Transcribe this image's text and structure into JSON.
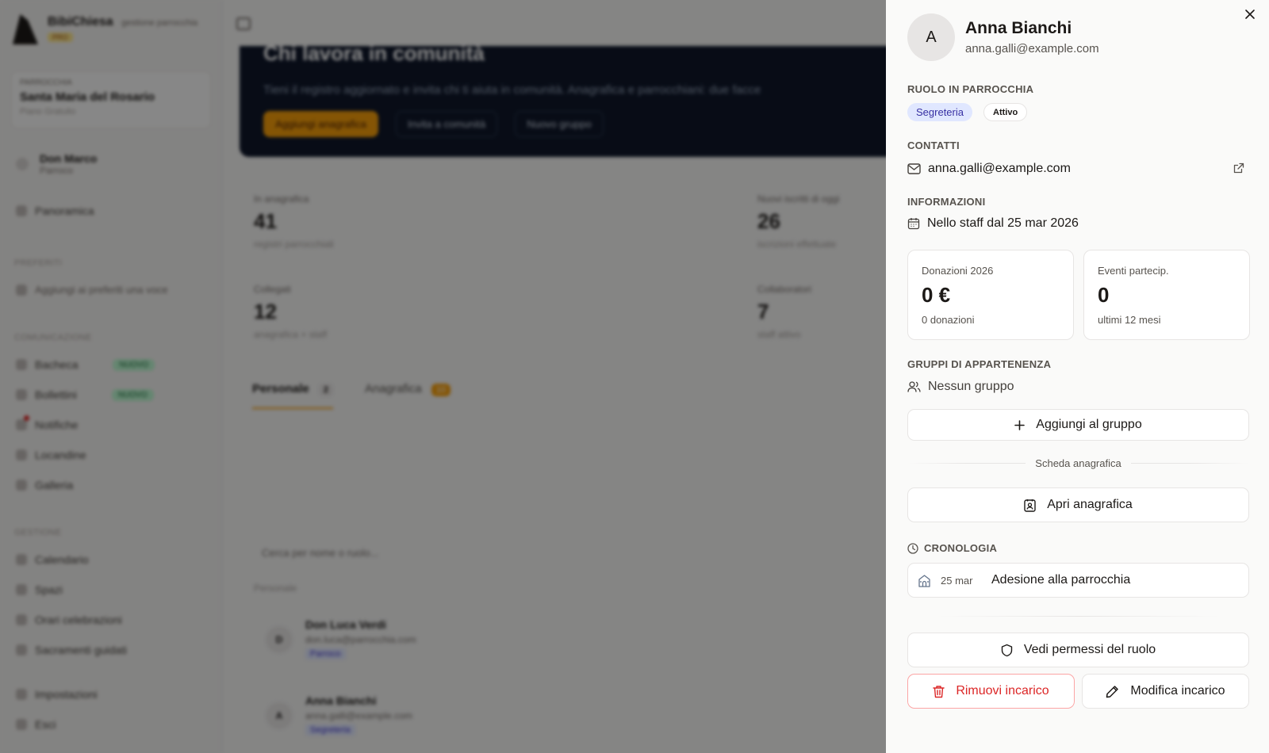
{
  "background": {
    "brand": {
      "name": "BibiChiesa",
      "tagline": "gestione parrocchia",
      "plan": "PRO"
    },
    "parish": {
      "label": "PARROCCHIA",
      "name": "Santa Maria del Rosario",
      "subtitle": "Piano Gratuito"
    },
    "current_user": {
      "name": "Don Marco",
      "role": "Parroco"
    },
    "sidebar": {
      "top_item": "Panoramica",
      "favorites_label": "PREFERITI",
      "favorite_item": "Aggiungi ai preferiti una voce",
      "community_label": "COMUNICAZIONE",
      "community_items": [
        {
          "label": "Bacheca",
          "badge": "NUOVO"
        },
        {
          "label": "Bollettini",
          "badge": "NUOVO"
        },
        {
          "label": "Notifiche",
          "badge": ""
        },
        {
          "label": "Locandine",
          "badge": ""
        },
        {
          "label": "Galleria",
          "badge": ""
        }
      ],
      "manage_label": "GESTIONE",
      "manage_items": [
        "Calendario",
        "Spazi",
        "Orari celebrazioni",
        "Sacramenti guidati"
      ],
      "bottom_items": [
        "Impostazioni",
        "Esci"
      ]
    },
    "hero": {
      "title": "Chi lavora in comunità",
      "text": "Tieni il registro aggiornato e invita chi ti aiuta in comunità. Anagrafica e parrocchiani: due facce",
      "buttons": [
        "Aggiungi anagrafica",
        "Invita a comunità",
        "Nuovo gruppo"
      ]
    },
    "stats": [
      {
        "label": "In anagrafica",
        "value": "41",
        "sub": "registri parrocchiali"
      },
      {
        "label": "Nuovi iscritti di oggi",
        "value": "26",
        "sub": "iscrizioni effettuate"
      },
      {
        "label": "Collegati",
        "value": "12",
        "sub": "anagrafica + staff"
      },
      {
        "label": "Collaboratori",
        "value": "7",
        "sub": "staff attivo"
      }
    ],
    "tabs": [
      {
        "label": "Personale",
        "count": "2"
      },
      {
        "label": "Anagrafica",
        "count": "10"
      }
    ],
    "search_placeholder": "Cerca per nome o ruolo...",
    "list_label": "Personale",
    "people": [
      {
        "initial": "D",
        "name": "Don Luca Verdi",
        "email": "don.luca@parrocchia.com",
        "role": "Parroco"
      },
      {
        "initial": "A",
        "name": "Anna Bianchi",
        "email": "anna.galli@example.com",
        "role": "Segreteria"
      }
    ]
  },
  "drawer": {
    "avatar_initial": "A",
    "name": "Anna Bianchi",
    "email": "anna.galli@example.com",
    "role_section": "RUOLO IN PARROCCHIA",
    "role": "Segreteria",
    "status": "Attivo",
    "contacts_section": "CONTATTI",
    "contact_email": "anna.galli@example.com",
    "info_section": "INFORMAZIONI",
    "staff_since": "Nello staff dal 25 mar 2026",
    "donations": {
      "label": "Donazioni 2026",
      "value": "0 €",
      "sub": "0 donazioni"
    },
    "events": {
      "label": "Eventi partecip.",
      "value": "0",
      "sub": "ultimi 12 mesi"
    },
    "groups_section": "GRUPPI DI APPARTENENZA",
    "no_group": "Nessun gruppo",
    "add_group_button": "Aggiungi al gruppo",
    "registry_divider": "Scheda anagrafica",
    "open_registry_button": "Apri anagrafica",
    "timeline_section": "CRONOLOGIA",
    "timeline": [
      {
        "date": "25 mar",
        "text": "Adesione alla parrocchia"
      }
    ],
    "permissions_button": "Vedi permessi del ruolo",
    "remove_button": "Rimuovi incarico",
    "edit_button": "Modifica incarico"
  },
  "colors": {
    "role_pill_bg": "#e0e7ff",
    "role_pill_text": "#3730a3",
    "danger": "#dc2626",
    "hero_bg": "#0f172a",
    "accent": "#f59e0b"
  }
}
